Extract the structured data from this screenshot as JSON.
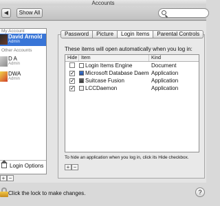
{
  "window": {
    "title": "Accounts"
  },
  "toolbar": {
    "back_label": "◀",
    "forward_label": "▶",
    "show_all_label": "Show All",
    "search_placeholder": ""
  },
  "sidebar": {
    "my_account_label": "My Account",
    "other_accounts_label": "Other Accounts",
    "accounts": [
      {
        "name": "David Arnold",
        "role": "Admin",
        "selected": true
      },
      {
        "name": "D A",
        "role": "Admin",
        "selected": false
      },
      {
        "name": "DWA",
        "role": "Admin",
        "selected": false
      }
    ],
    "login_options_label": "Login Options",
    "add_label": "+",
    "remove_label": "−"
  },
  "tabs": [
    {
      "label": "Password",
      "active": false
    },
    {
      "label": "Picture",
      "active": false
    },
    {
      "label": "Login Items",
      "active": true
    },
    {
      "label": "Parental Controls",
      "active": false
    }
  ],
  "login_items": {
    "intro": "These items will open automatically when you log in:",
    "columns": {
      "hide": "Hide",
      "item": "Item",
      "kind": "Kind"
    },
    "rows": [
      {
        "hide": false,
        "item": "Login Items Engine",
        "kind": "Document",
        "icon": "document-icon"
      },
      {
        "hide": true,
        "item": "Microsoft Database Daemo",
        "kind": "Application",
        "icon": "microsoft-database-icon"
      },
      {
        "hide": true,
        "item": "Suitcase Fusion",
        "kind": "Application",
        "icon": "suitcase-fusion-icon"
      },
      {
        "hide": true,
        "item": "LCCDaemon",
        "kind": "Application",
        "icon": "lccdaemon-icon"
      }
    ],
    "hint": "To hide an application when you log in, click its Hide checkbox.",
    "add_label": "+",
    "remove_label": "−"
  },
  "footer": {
    "lock_text": "Click the lock to make changes.",
    "help_label": "?"
  },
  "colors": {
    "selection": "#3875d7",
    "window_bg": "#e4e4e4"
  }
}
